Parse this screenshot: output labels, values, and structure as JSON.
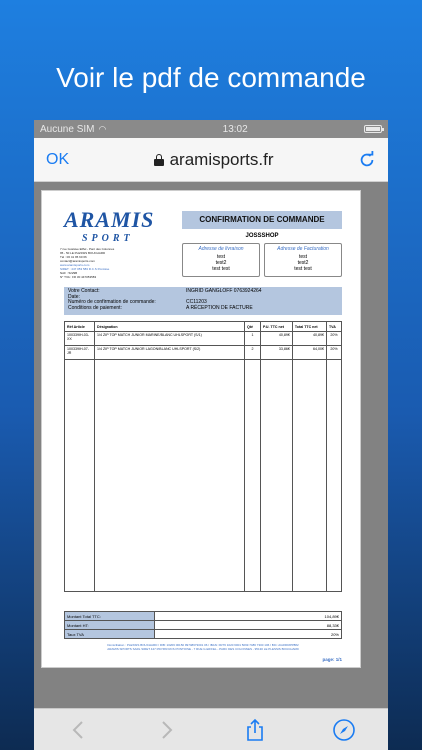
{
  "headline": "Voir le pdf de commande",
  "status": {
    "carrier": "Aucune SIM",
    "time": "13:02"
  },
  "nav": {
    "ok_label": "OK",
    "url": "aramisports.fr"
  },
  "pdf": {
    "logo_main": "ARAMIS",
    "logo_sub": "SPORT",
    "company_lines": [
      "7 rue Gustave Eiffel - Parc des Colonnes",
      "95 - 50 LE PLESSIS BOUCHARD",
      "Tél : 06 41 95 60 66",
      "contact@aramisports.com",
      "www.aramisports.com",
      "SIRET : 447 053 583 R.C.S Pontoise",
      "NAF : 5229B",
      "N° TVA : FR 30 447053583"
    ],
    "title": "CONFIRMATION DE COMMANDE",
    "shop": "JOSSSHOP",
    "livraison": {
      "label": "Adresse de livraison",
      "lines": [
        "test",
        "test2",
        "test test"
      ]
    },
    "facturation": {
      "label": "Adresse de Facturation",
      "lines": [
        "test",
        "test2",
        "test test"
      ]
    },
    "contact": [
      {
        "k": "Votre Contact:",
        "v": "INGRID GANGLOFF   0763924264"
      },
      {
        "k": "Date:",
        "v": ""
      },
      {
        "k": "Numéro de confirmation de commande:",
        "v": "CC11203"
      },
      {
        "k": "Conditions de paiement:",
        "v": "A RÉCEPTION DE FACTURE"
      }
    ],
    "items_headers": [
      "Réf Article",
      "Désignation",
      "Qté",
      "P.U. TTC net",
      "Total TTC net",
      "TVA"
    ],
    "items": [
      {
        "ref": "100339IH-03-XX",
        "desc": "1/4 ZIP TOP MATCH JUNIOR MARINE/BLANC UHLSPORT (S/1)",
        "qty": "1",
        "pu": "40,89€",
        "total": "40,89€",
        "tva": "20%"
      },
      {
        "ref": "100339IH-07-JR",
        "desc": "1/4 ZIP TOP MATCH JUNIOR LAGON/BLANC UHLSPORT (S/2)",
        "qty": "2",
        "pu": "33,86€",
        "total": "64,00€",
        "tva": "20%"
      }
    ],
    "totals": [
      {
        "k": "Montant Total TTC:",
        "v": "104,89€"
      },
      {
        "k": "Montant HT:",
        "v": "88,33€"
      },
      {
        "k": "Taux TVA",
        "v": "20%"
      }
    ],
    "footer_lines": [
      "Domiciliation : PLESSIS BOUCHARD / RIB: 10206 00150 99748673001 06 / IBAN: FR76 1020 6001 5099 7486 7300 106 / BIC: AGRIFRPP882",
      "ARAMIS SPORTS SARL SIRET 447 053 583 RCS PONTOISE - 7 RUE G.EIFFEL - PARC DES COLONNES - 95130 LE PLESSIS BOUCHARD"
    ],
    "page": "page: 1/1"
  }
}
